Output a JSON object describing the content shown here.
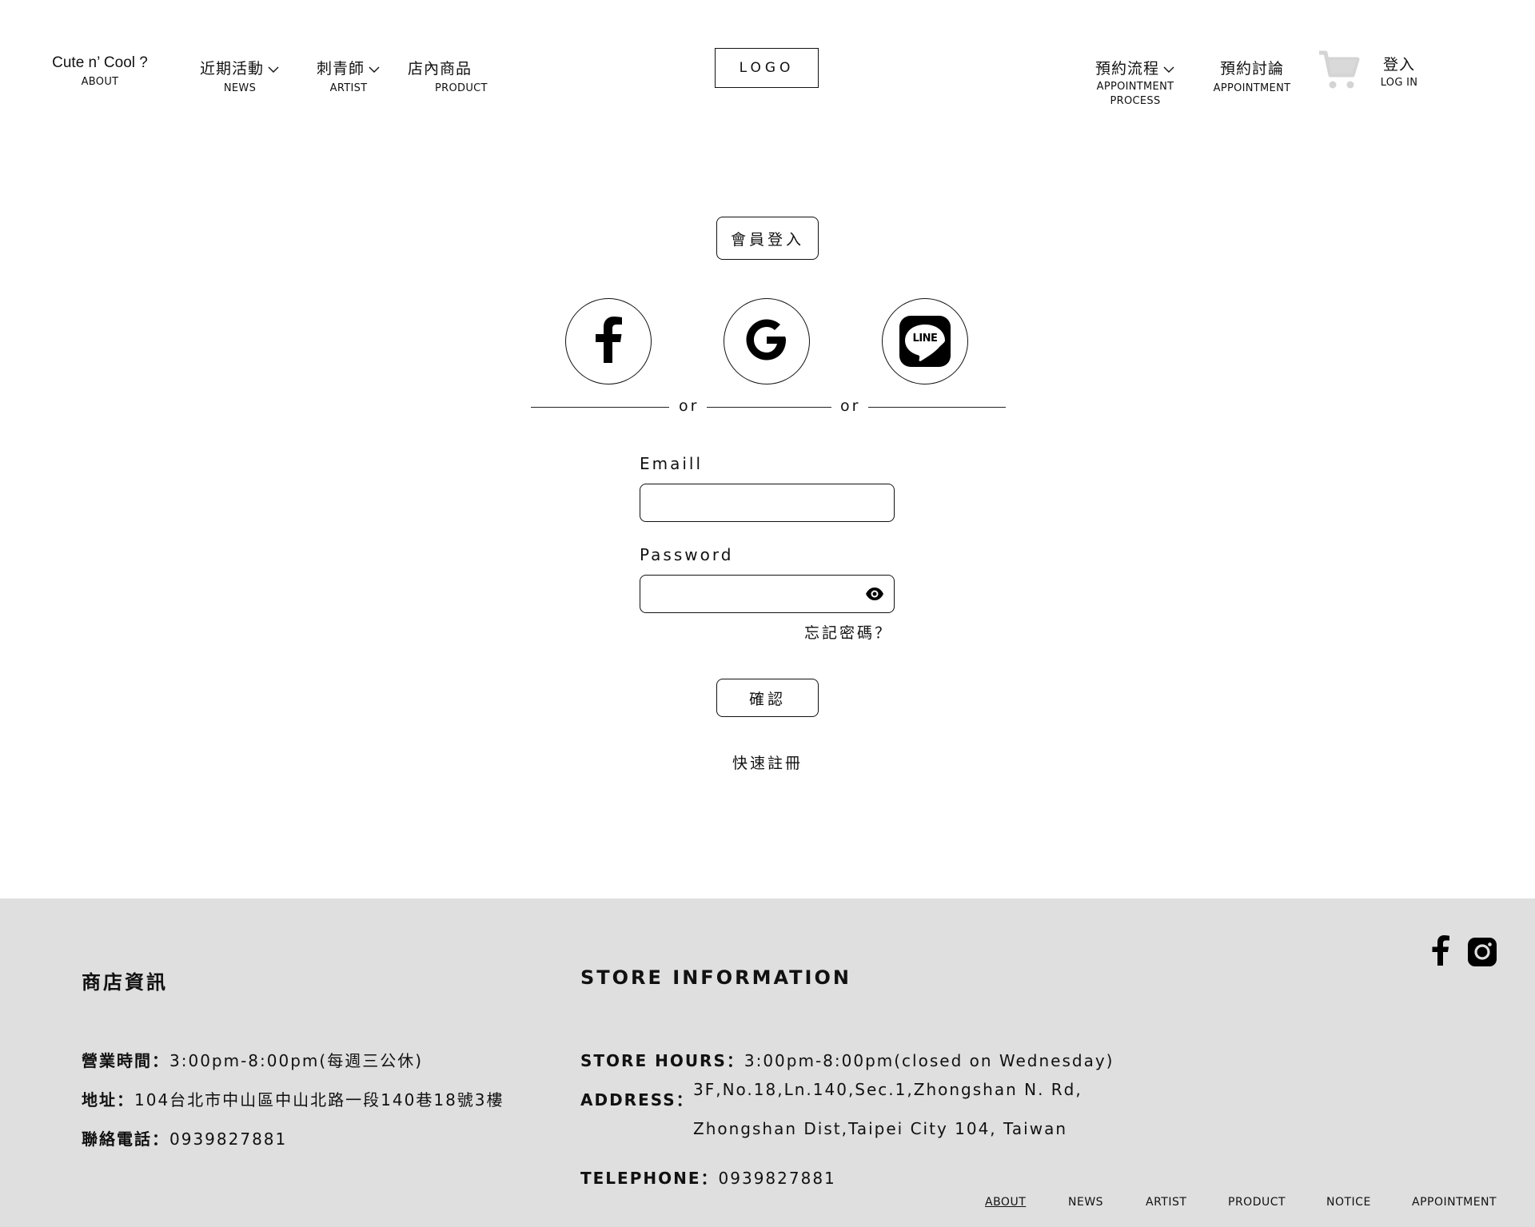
{
  "header": {
    "nav_left": [
      {
        "main": "Cute n’ Cool ?",
        "sub": "ABOUT"
      },
      {
        "main": "近期活動",
        "sub": "NEWS"
      },
      {
        "main": "刺青師",
        "sub": "ARTIST"
      },
      {
        "main": "店內商品",
        "sub": "PRODUCT"
      }
    ],
    "logo": "LOGO",
    "nav_right": [
      {
        "main": "預約流程",
        "sub": "APPOINTMENT",
        "sub2": "PROCESS"
      },
      {
        "main": "預約討論",
        "sub": "APPOINTMENT"
      }
    ],
    "login": {
      "main": "登入",
      "sub": "LOG IN"
    }
  },
  "login": {
    "title": "會員登入",
    "social_buttons": [
      "facebook",
      "google",
      "line"
    ],
    "line_badge": "LINE",
    "or_text": "or",
    "email_label": "Emaill",
    "email_value": "",
    "password_label": "Password",
    "password_value": "",
    "forgot": "忘記密碼？",
    "confirm": "確認",
    "register": "快速註冊"
  },
  "footer": {
    "zh_heading": "商店資訊",
    "zh_hours_key": "營業時間：",
    "zh_hours_val": "3:00pm-8:00pm(每週三公休)",
    "zh_addr_key": "地址：",
    "zh_addr_val": "104台北市中山區中山北路一段140巷18號3樓",
    "zh_tel_key": "聯絡電話：",
    "zh_tel_val": "0939827881",
    "en_heading": "STORE INFORMATION",
    "en_hours_key": "STORE HOURS：",
    "en_hours_val": "3:00pm-8:00pm(closed on Wednesday)",
    "en_addr_key": "ADDRESS：",
    "en_addr_line1": "3F,No.18,Ln.140,Sec.1,Zhongshan N. Rd,",
    "en_addr_line2": "Zhongshan Dist,Taipei City 104, Taiwan",
    "en_tel_key": "TELEPHONE：",
    "en_tel_val": "0939827881",
    "nav": [
      "ABOUT",
      "NEWS",
      "ARTIST",
      "PRODUCT",
      "NOTICE",
      "APPOINTMENT"
    ]
  },
  "colors": {
    "footer_bg": "#dfdfdf",
    "text": "#111111",
    "cart": "#d9d9d9"
  }
}
